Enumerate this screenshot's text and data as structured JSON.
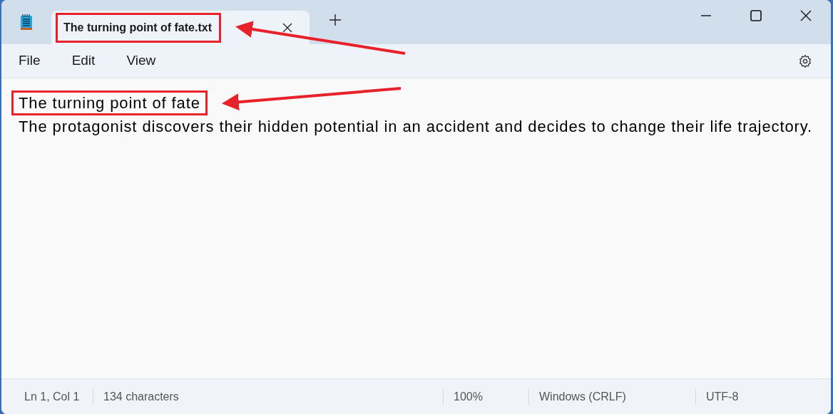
{
  "tabs": [
    {
      "title": "The turning point of fate.txt",
      "selected": true,
      "highlighted": true
    }
  ],
  "menu": [
    "File",
    "Edit",
    "View"
  ],
  "editor": {
    "lines": [
      {
        "text": "The turning point of fate",
        "highlighted": true
      },
      {
        "text": "The protagonist discovers their hidden potential in an accident and decides to change their life trajectory.",
        "highlighted": false
      }
    ]
  },
  "status_bar": [
    "Ln 1, Col 1",
    "134 characters",
    "100%",
    "Windows (CRLF)",
    "UTF-8"
  ]
}
